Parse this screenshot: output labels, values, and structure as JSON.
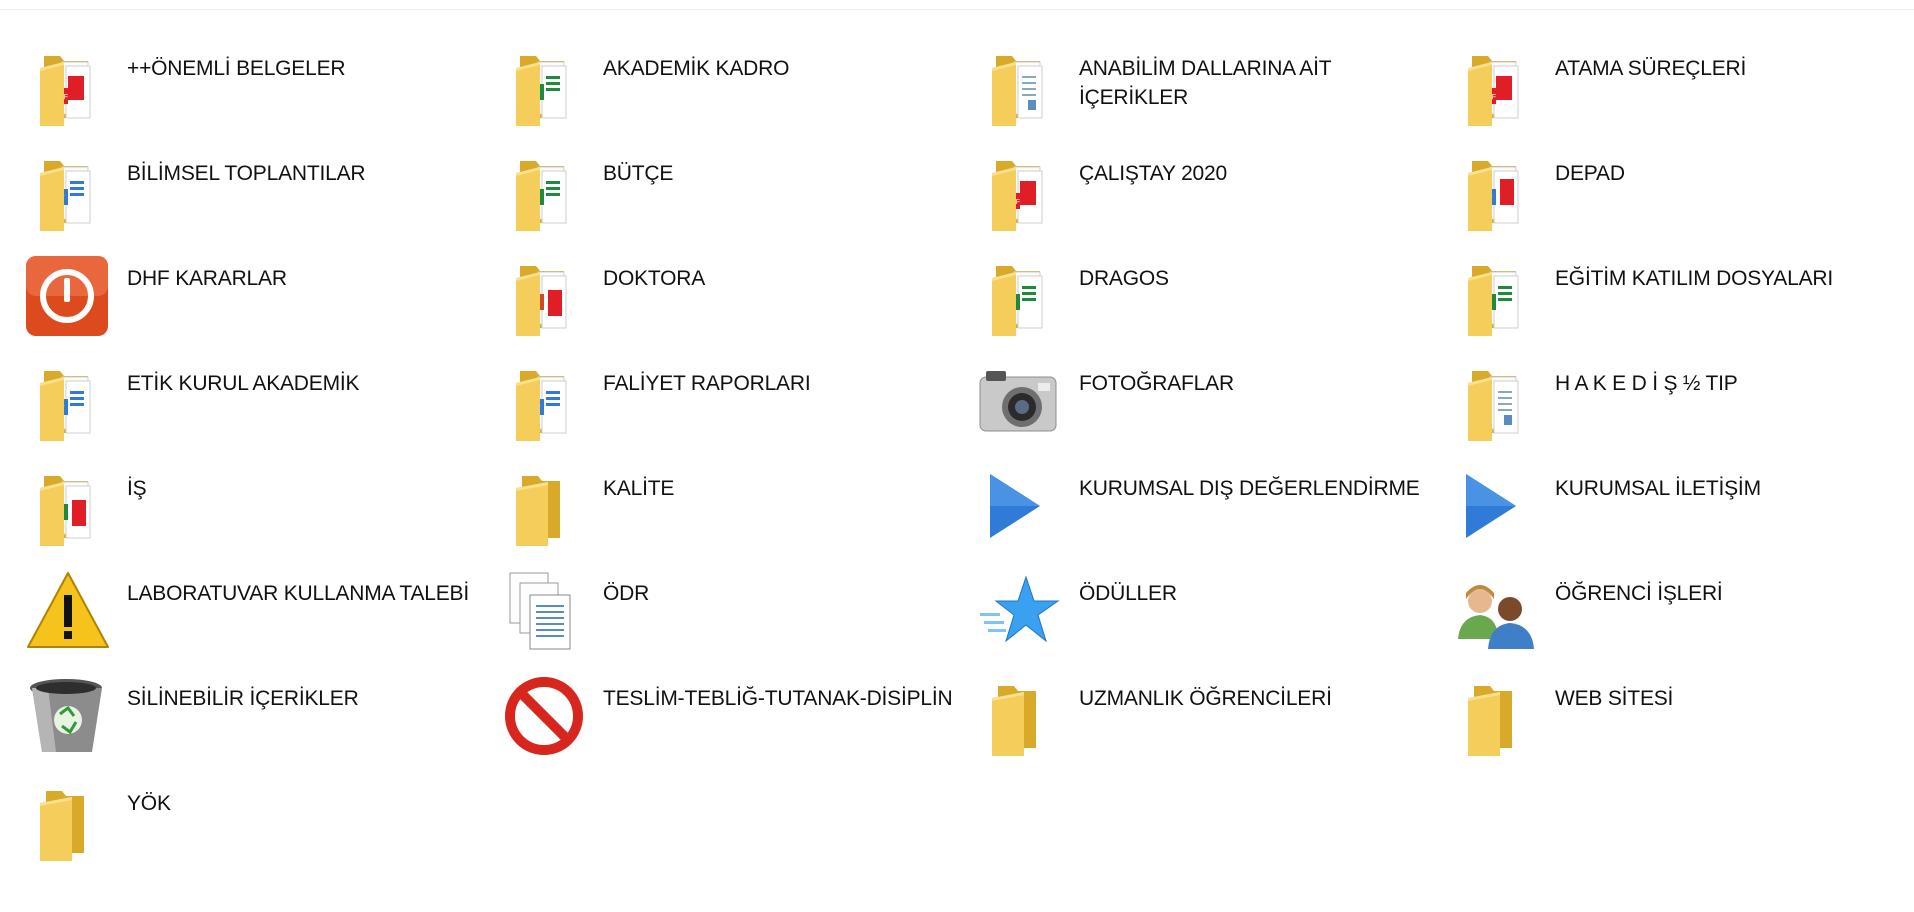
{
  "view": "large-icons",
  "colors": {
    "folder": "#f4cd5a",
    "folder_dark": "#d9a92a",
    "accent_blue": "#2f7bd7",
    "pdf_red": "#e01e25",
    "excel_green": "#1e8a3e"
  },
  "items": [
    {
      "label": "++ÖNEMLİ BELGELER",
      "icon": "folder-pdf-icon"
    },
    {
      "label": "AKADEMİK KADRO",
      "icon": "folder-excel-icon"
    },
    {
      "label": "ANABİLİM DALLARINA AİT İÇERİKLER",
      "icon": "folder-doc-icon"
    },
    {
      "label": "ATAMA SÜREÇLERİ",
      "icon": "folder-pdf-icon"
    },
    {
      "label": "BİLİMSEL TOPLANTILAR",
      "icon": "folder-word-icon"
    },
    {
      "label": "BÜTÇE",
      "icon": "folder-excel-icon"
    },
    {
      "label": "ÇALIŞTAY 2020",
      "icon": "folder-pdf-icon"
    },
    {
      "label": "DEPAD",
      "icon": "folder-word-pdf-icon"
    },
    {
      "label": "DHF KARARLAR",
      "icon": "power-icon"
    },
    {
      "label": "DOKTORA",
      "icon": "folder-ppt-icon"
    },
    {
      "label": "DRAGOS",
      "icon": "folder-excel-icon"
    },
    {
      "label": "EĞİTİM KATILIM DOSYALARI",
      "icon": "folder-excel-icon"
    },
    {
      "label": "ETİK KURUL AKADEMİK",
      "icon": "folder-word-icon"
    },
    {
      "label": "FALİYET RAPORLARI",
      "icon": "folder-word-icon"
    },
    {
      "label": "FOTOĞRAFLAR",
      "icon": "camera-icon"
    },
    {
      "label": "H A K E D İ Ş ½ TIP",
      "icon": "folder-doc-icon"
    },
    {
      "label": "İŞ",
      "icon": "folder-excel-pdf-icon"
    },
    {
      "label": "KALİTE",
      "icon": "folder-icon"
    },
    {
      "label": "KURUMSAL DIŞ DEĞERLENDİRME",
      "icon": "play-icon"
    },
    {
      "label": "KURUMSAL İLETİŞİM",
      "icon": "play-icon"
    },
    {
      "label": "LABORATUVAR KULLANMA TALEBİ",
      "icon": "warning-icon"
    },
    {
      "label": "ÖDR",
      "icon": "documents-icon"
    },
    {
      "label": "ÖDÜLLER",
      "icon": "star-icon"
    },
    {
      "label": "ÖĞRENCİ İŞLERİ",
      "icon": "users-icon"
    },
    {
      "label": "SİLİNEBİLİR İÇERİKLER",
      "icon": "recycle-bin-icon"
    },
    {
      "label": "TESLİM-TEBLİĞ-TUTANAK-DİSİPLİN",
      "icon": "no-entry-icon"
    },
    {
      "label": "UZMANLIK ÖĞRENCİLERİ",
      "icon": "folder-icon"
    },
    {
      "label": "WEB SİTESİ",
      "icon": "folder-icon"
    },
    {
      "label": "YÖK",
      "icon": "folder-icon"
    }
  ]
}
